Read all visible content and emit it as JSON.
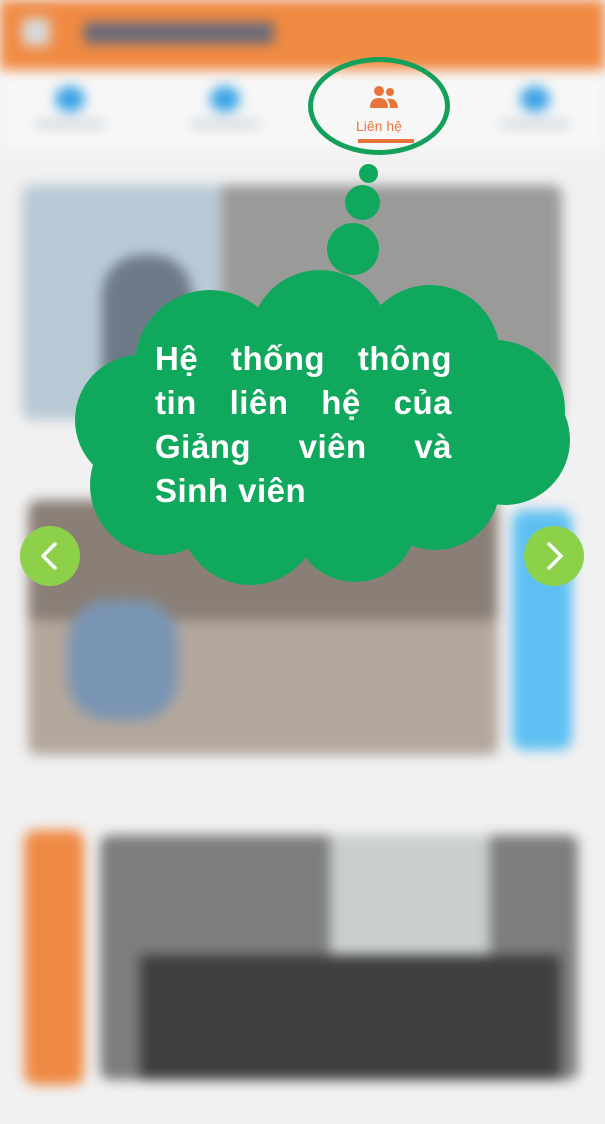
{
  "tabs": {
    "active": {
      "label": "Liên hệ",
      "icon": "contacts-icon"
    }
  },
  "callout": {
    "text": "Hệ thống thông tin liên hệ của Giảng viên và Sinh viên"
  },
  "navigation": {
    "previous_icon": "chevron-left-icon",
    "next_icon": "chevron-right-icon"
  },
  "colors": {
    "accent_orange": "#e8743b",
    "callout_green": "#10a85c",
    "nav_green": "#8dd14a",
    "header_orange": "#f08a42"
  }
}
